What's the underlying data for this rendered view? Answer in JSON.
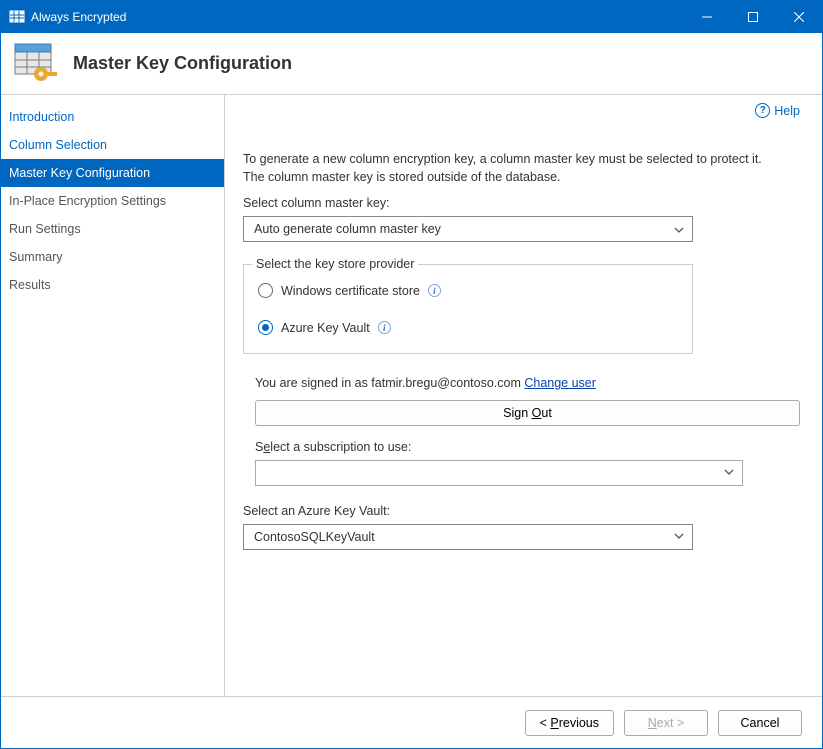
{
  "window": {
    "title": "Always Encrypted"
  },
  "header": {
    "title": "Master Key Configuration"
  },
  "sidebar": {
    "items": [
      {
        "label": "Introduction",
        "state": "done"
      },
      {
        "label": "Column Selection",
        "state": "done"
      },
      {
        "label": "Master Key Configuration",
        "state": "active"
      },
      {
        "label": "In-Place Encryption Settings",
        "state": "future"
      },
      {
        "label": "Run Settings",
        "state": "future"
      },
      {
        "label": "Summary",
        "state": "future"
      },
      {
        "label": "Results",
        "state": "future"
      }
    ]
  },
  "help": {
    "label": "Help"
  },
  "main": {
    "intro": "To generate a new column encryption key, a column master key must be selected to protect it.  The column master key is stored outside of the database.",
    "select_cmk_label": "Select column master key:",
    "select_cmk_value": "Auto generate column master key",
    "keystore": {
      "legend": "Select the key store provider",
      "opt1": "Windows certificate store",
      "opt2": "Azure Key Vault"
    },
    "signed_in_prefix": "You are signed in as ",
    "signed_in_email": "fatmir.bregu@contoso.com ",
    "change_user": "Change user",
    "sign_out_prefix": "Sign ",
    "sign_out_letter": "O",
    "sign_out_suffix": "ut",
    "sub_label_prefix": "S",
    "sub_label_letter": "e",
    "sub_label_suffix": "lect a subscription to use:",
    "sub_value": "",
    "kv_label": "Select an Azure Key Vault:",
    "kv_value": "ContosoSQLKeyVault"
  },
  "footer": {
    "previous_prefix": "< ",
    "previous_letter": "P",
    "previous_suffix": "revious",
    "next_prefix": "",
    "next_letter": "N",
    "next_suffix": "ext >",
    "cancel": "Cancel"
  }
}
